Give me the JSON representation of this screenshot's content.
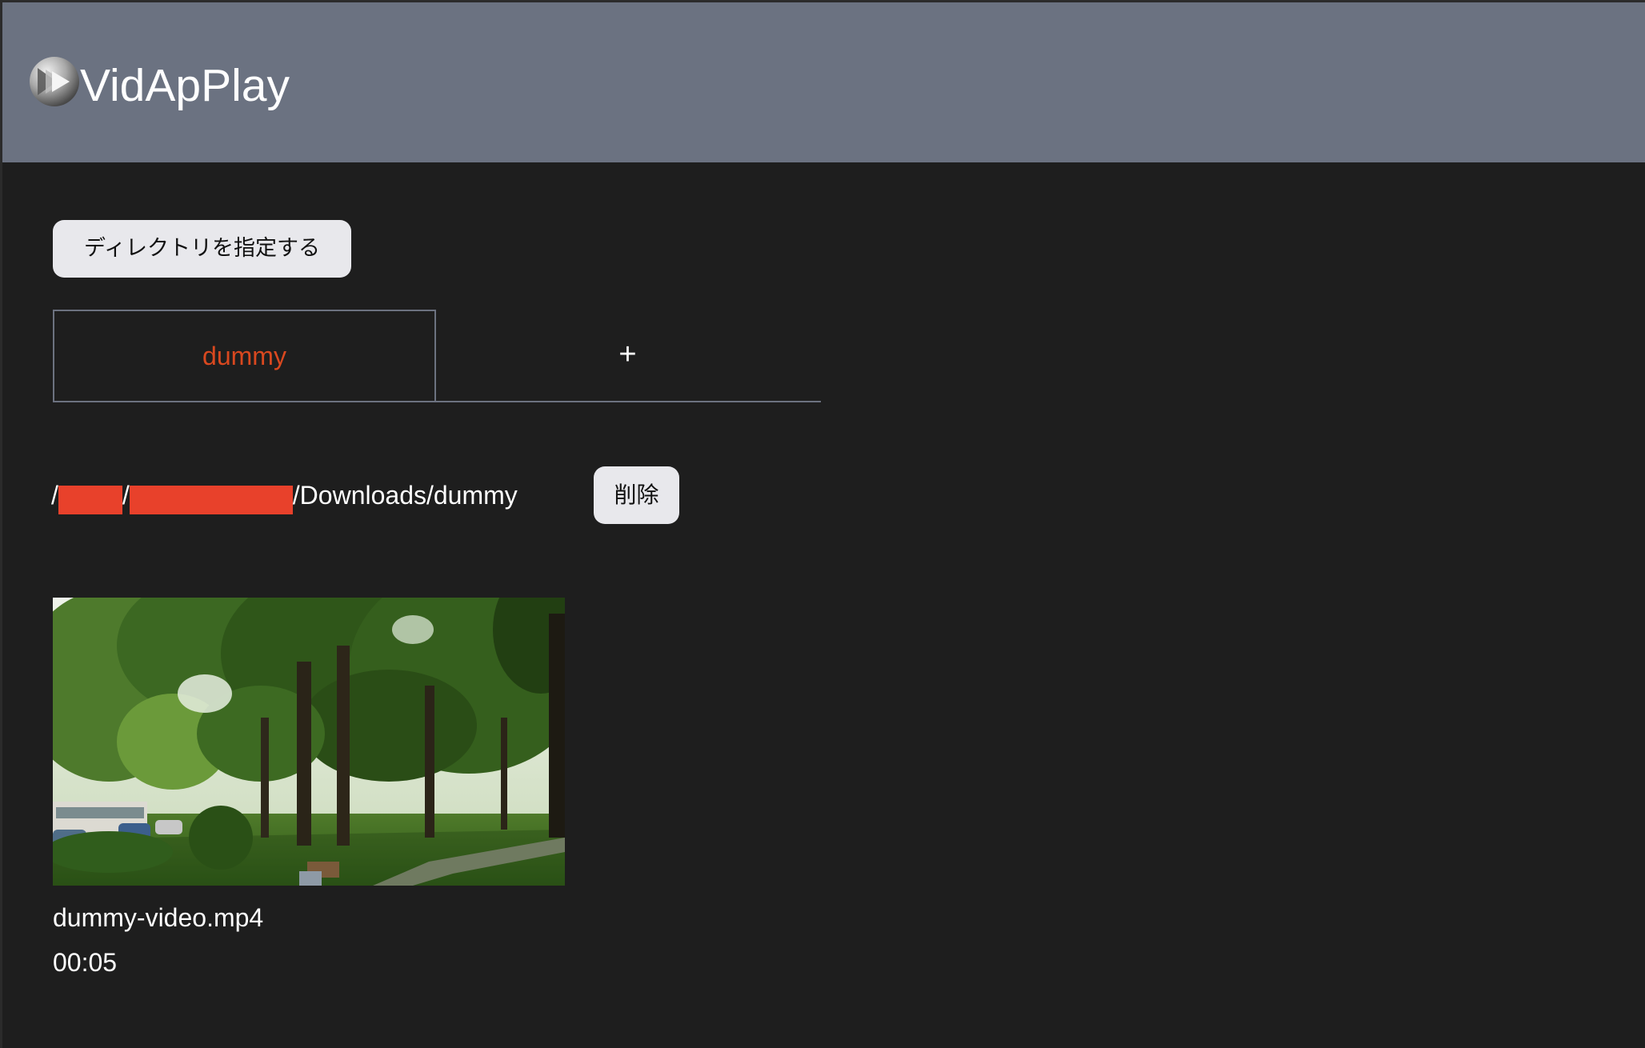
{
  "header": {
    "title": "VidApPlay",
    "logo_icon": "play-logo-icon",
    "background_color": "#6b7281"
  },
  "actions": {
    "choose_directory_label": "ディレクトリを指定する"
  },
  "tabs": [
    {
      "label": "dummy",
      "active": true,
      "color": "#d9481f"
    },
    {
      "label": "+",
      "active": false
    }
  ],
  "path": {
    "prefix": "/",
    "separator": "/",
    "suffix": "/Downloads/dummy",
    "redacted_color": "#e8412b"
  },
  "delete_label": "削除",
  "videos": [
    {
      "name": "dummy-video.mp4",
      "duration": "00:05"
    }
  ],
  "colors": {
    "background": "#1e1e1e",
    "button": "#e8e8ec",
    "tab_border": "#6c7280"
  }
}
